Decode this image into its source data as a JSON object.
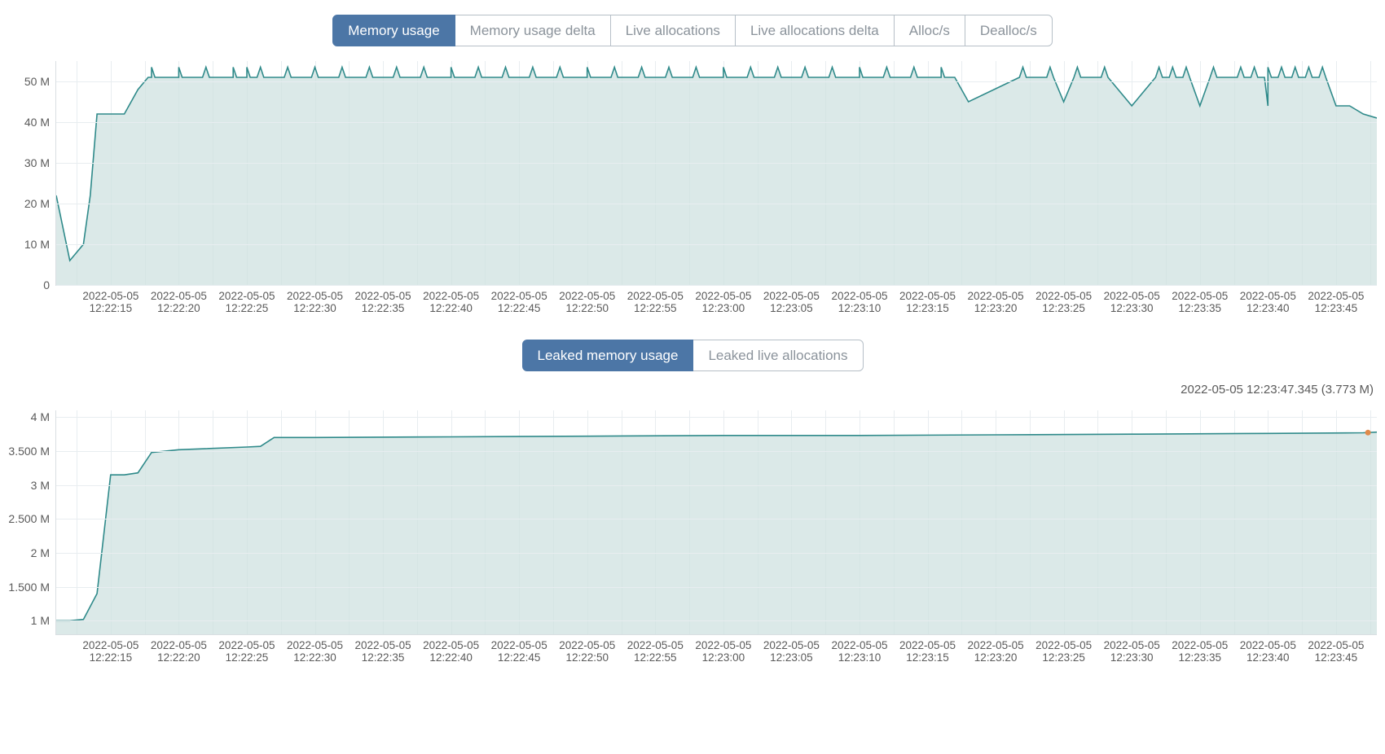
{
  "tabs_top": {
    "items": [
      {
        "label": "Memory usage",
        "active": true
      },
      {
        "label": "Memory usage delta",
        "active": false
      },
      {
        "label": "Live allocations",
        "active": false
      },
      {
        "label": "Live allocations delta",
        "active": false
      },
      {
        "label": "Alloc/s",
        "active": false
      },
      {
        "label": "Dealloc/s",
        "active": false
      }
    ]
  },
  "tabs_mid": {
    "items": [
      {
        "label": "Leaked memory usage",
        "active": true
      },
      {
        "label": "Leaked live allocations",
        "active": false
      }
    ]
  },
  "hover_label": "2022-05-05 12:23:47.345 (3.773 M)",
  "xaxis": {
    "date": "2022-05-05",
    "times": [
      "12:22:15",
      "12:22:20",
      "12:22:25",
      "12:22:30",
      "12:22:35",
      "12:22:40",
      "12:22:45",
      "12:22:50",
      "12:22:55",
      "12:23:00",
      "12:23:05",
      "12:23:10",
      "12:23:15",
      "12:23:20",
      "12:23:25",
      "12:23:30",
      "12:23:35",
      "12:23:40",
      "12:23:45"
    ]
  },
  "chart_data": [
    {
      "name": "memory_usage",
      "type": "area",
      "ylabel": "",
      "ylim": [
        0,
        55
      ],
      "yticks": [
        {
          "value": 0,
          "label": "0"
        },
        {
          "value": 10,
          "label": "10 M"
        },
        {
          "value": 20,
          "label": "20 M"
        },
        {
          "value": 30,
          "label": "30 M"
        },
        {
          "value": 40,
          "label": "40 M"
        },
        {
          "value": 50,
          "label": "50 M"
        }
      ],
      "x_seconds": [
        11,
        12,
        13,
        13.5,
        14,
        15,
        16,
        17,
        18,
        19,
        20,
        21,
        24,
        25,
        27,
        31,
        40,
        50,
        60,
        70,
        76,
        77,
        78,
        85,
        90,
        95,
        100,
        105,
        106,
        107,
        108
      ],
      "values": [
        22,
        6,
        10,
        22,
        42,
        42,
        42,
        48,
        51,
        51,
        51,
        51,
        51,
        51,
        51,
        51,
        51,
        51,
        51,
        51,
        51,
        51,
        45,
        45,
        44,
        44,
        44,
        44,
        44,
        42,
        41
      ],
      "spikes_at_seconds": [
        18,
        20,
        22,
        24,
        25,
        26,
        28,
        30,
        32,
        34,
        36,
        38,
        40,
        42,
        44,
        46,
        48,
        50,
        52,
        54,
        56,
        58,
        60,
        62,
        64,
        66,
        68,
        70,
        72,
        74,
        76
      ],
      "spikes2_at_seconds": [
        82,
        84,
        86,
        88,
        92,
        93,
        94,
        96,
        98,
        99,
        100,
        101,
        102,
        103,
        104
      ]
    },
    {
      "name": "leaked_memory_usage",
      "type": "area",
      "ylabel": "",
      "ylim": [
        0.8,
        4.1
      ],
      "yticks": [
        {
          "value": 1.0,
          "label": "1 M"
        },
        {
          "value": 1.5,
          "label": "1.500 M"
        },
        {
          "value": 2.0,
          "label": "2 M"
        },
        {
          "value": 2.5,
          "label": "2.500 M"
        },
        {
          "value": 3.0,
          "label": "3 M"
        },
        {
          "value": 3.5,
          "label": "3.500 M"
        },
        {
          "value": 4.0,
          "label": "4 M"
        }
      ],
      "x_seconds": [
        11,
        12,
        13,
        14,
        15,
        16,
        17,
        18,
        20,
        25,
        26,
        27,
        28,
        30,
        40,
        50,
        60,
        70,
        80,
        90,
        100,
        107,
        108
      ],
      "values": [
        1.0,
        1.0,
        1.02,
        1.4,
        3.15,
        3.15,
        3.18,
        3.48,
        3.52,
        3.56,
        3.57,
        3.7,
        3.7,
        3.7,
        3.71,
        3.72,
        3.73,
        3.73,
        3.74,
        3.75,
        3.76,
        3.77,
        3.78
      ],
      "hover_point": {
        "x_seconds": 107.345,
        "value": 3.773
      }
    }
  ]
}
